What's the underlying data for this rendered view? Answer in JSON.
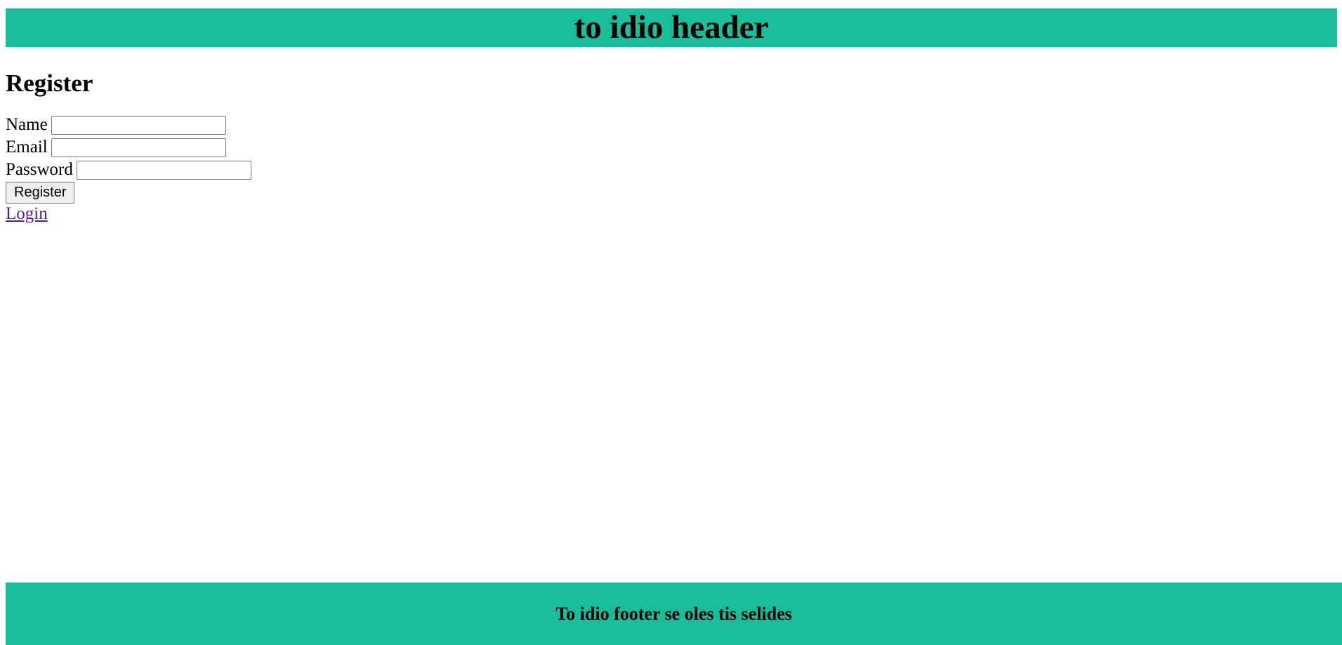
{
  "header": {
    "title": "to idio header"
  },
  "main": {
    "heading": "Register",
    "fields": {
      "name_label": "Name",
      "name_value": "",
      "email_label": "Email",
      "email_value": "",
      "password_label": "Password",
      "password_value": ""
    },
    "submit_label": "Register",
    "login_link": "Login"
  },
  "footer": {
    "text": "To idio footer se oles tis selides"
  },
  "colors": {
    "header_bg": "#1abc9c",
    "footer_bg": "#1abc9c",
    "visited_link": "#551a8b"
  }
}
